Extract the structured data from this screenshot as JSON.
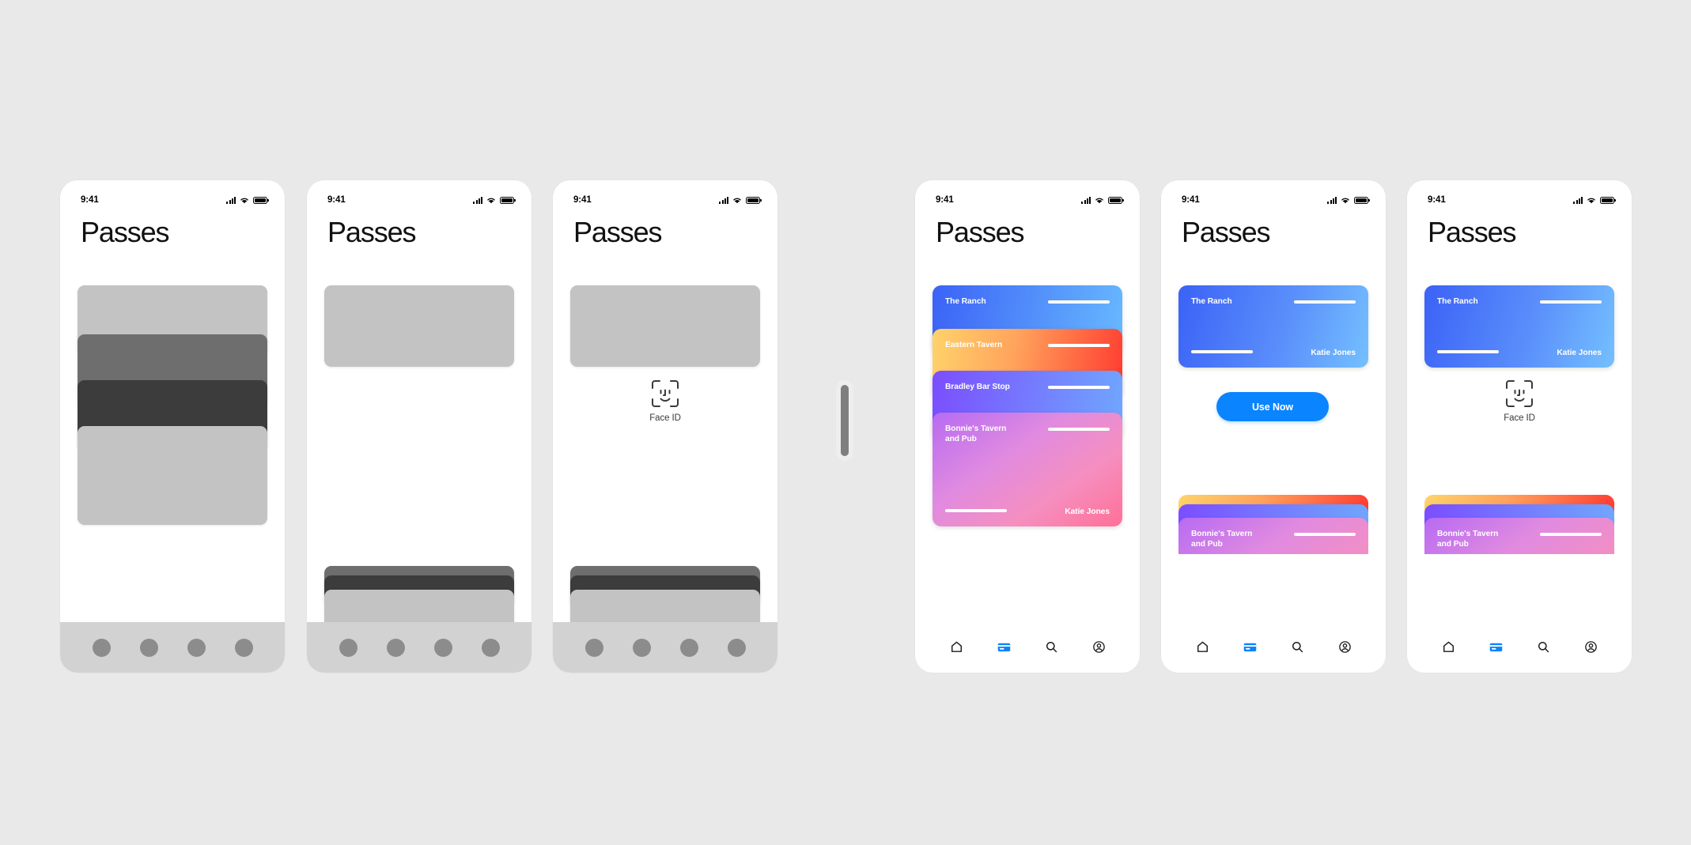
{
  "canvas": {
    "background": "#e9e9e9"
  },
  "statusbar": {
    "time": "9:41",
    "signal_icon": "cellular-signal-icon",
    "wifi_icon": "wifi-icon",
    "battery_icon": "battery-icon"
  },
  "page": {
    "title": "Passes"
  },
  "faceid": {
    "label": "Face ID",
    "icon": "face-id-icon"
  },
  "divider": {
    "name": "fidelity-divider"
  },
  "tabbar": {
    "items": [
      {
        "name": "tab-home",
        "icon": "home-icon",
        "active": false
      },
      {
        "name": "tab-passes",
        "icon": "card-icon",
        "active": true
      },
      {
        "name": "tab-search",
        "icon": "search-icon",
        "active": false
      },
      {
        "name": "tab-profile",
        "icon": "profile-icon",
        "active": false
      }
    ],
    "active_color": "#0a84ff",
    "inactive_color": "#1c1c1e"
  },
  "wireframe": {
    "placeholder_light": "#c3c3c3",
    "placeholder_mid": "#6e6e6e",
    "placeholder_dark": "#3c3c3c",
    "tabbar_bg": "#d2d2d2",
    "tabdot_color": "#8c8c8c"
  },
  "passes": [
    {
      "name": "The Ranch",
      "holder": "Katie Jones",
      "gradient_from": "#3b62f6",
      "gradient_to": "#68b9ff",
      "barcode_bar": "barcode-bar"
    },
    {
      "name": "Eastern Tavern",
      "holder": "Katie Jones",
      "gradient_from": "#ffd36b",
      "gradient_to": "#ff3b30",
      "barcode_bar": "barcode-bar"
    },
    {
      "name": "Bradley Bar Stop",
      "holder": "Katie Jones",
      "gradient_from": "#7b4dff",
      "gradient_to": "#6fa8ff",
      "barcode_bar": "barcode-bar"
    },
    {
      "name": "Bonnie's Tavern and Pub",
      "holder": "Katie Jones",
      "gradient_from": "#c06bf0",
      "gradient_to": "#ff7aa8",
      "barcode_bar": "barcode-bar"
    }
  ],
  "detail": {
    "use_now_label": "Use Now",
    "accent": "#0a84ff"
  },
  "screens": [
    {
      "id": "wireframe-list",
      "fidelity": "wireframe"
    },
    {
      "id": "wireframe-detail",
      "fidelity": "wireframe"
    },
    {
      "id": "wireframe-faceid",
      "fidelity": "wireframe"
    },
    {
      "id": "hifi-list",
      "fidelity": "high"
    },
    {
      "id": "hifi-detail-use-now",
      "fidelity": "high"
    },
    {
      "id": "hifi-detail-faceid",
      "fidelity": "high"
    }
  ]
}
